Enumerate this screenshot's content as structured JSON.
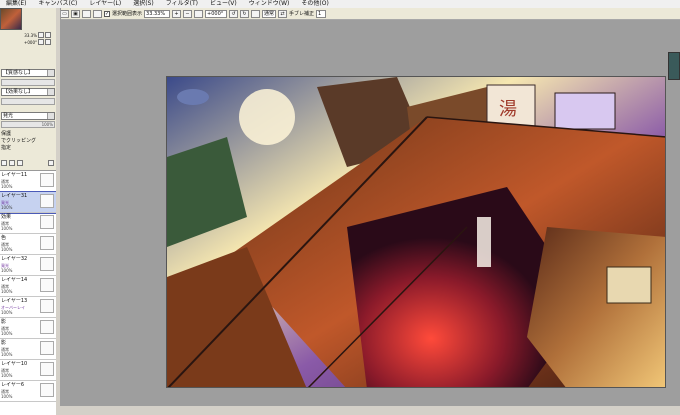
{
  "menubar": {
    "items": [
      "編集(E)",
      "キャンバス(C)",
      "レイヤー(L)",
      "選択(S)",
      "フィルタ(T)",
      "ビュー(V)",
      "ウィンドウ(W)",
      "その他(O)"
    ]
  },
  "toolbar": {
    "show_selection_label": "選択範囲表示",
    "zoom_value": "33.33%",
    "angle_value": "+000°",
    "mode_label": "通常",
    "stabilizer_label": "手ブレ補正",
    "stabilizer_value": "1"
  },
  "navigator": {
    "zoom_value": "33.3%",
    "angle_value": "+000°"
  },
  "layer_panel": {
    "paper_texture": "【質感なし】",
    "paper_effect": "【効果なし】",
    "blend_mode": "発光",
    "opacity_label": "100%",
    "options": [
      "保護",
      "でクリッピング",
      "指定"
    ],
    "layers": [
      {
        "name": "レイヤー11",
        "mode": "通常",
        "opacity": "100%"
      },
      {
        "name": "レイヤー31",
        "mode": "発光",
        "opacity": "100%"
      },
      {
        "name": "効果",
        "mode": "通常",
        "opacity": "100%"
      },
      {
        "name": "色",
        "mode": "通常",
        "opacity": "100%"
      },
      {
        "name": "レイヤー32",
        "mode": "発光",
        "opacity": "100%"
      },
      {
        "name": "レイヤー14",
        "mode": "通常",
        "opacity": "100%"
      },
      {
        "name": "レイヤー13",
        "mode": "オーバーレイ",
        "opacity": "100%"
      },
      {
        "name": "影",
        "mode": "通常",
        "opacity": "100%"
      },
      {
        "name": "影",
        "mode": "通常",
        "opacity": "100%"
      },
      {
        "name": "レイヤー10",
        "mode": "通常",
        "opacity": "100%"
      },
      {
        "name": "レイヤー6",
        "mode": "通常",
        "opacity": "100%"
      }
    ]
  },
  "colors": {
    "menubar_bg": "#f0f0f0",
    "panel_bg": "#ece9d8",
    "canvas_bg": "#9e9e9e",
    "selected_layer": "#c6d2f0",
    "accent_blend": "#6a2a9a"
  }
}
